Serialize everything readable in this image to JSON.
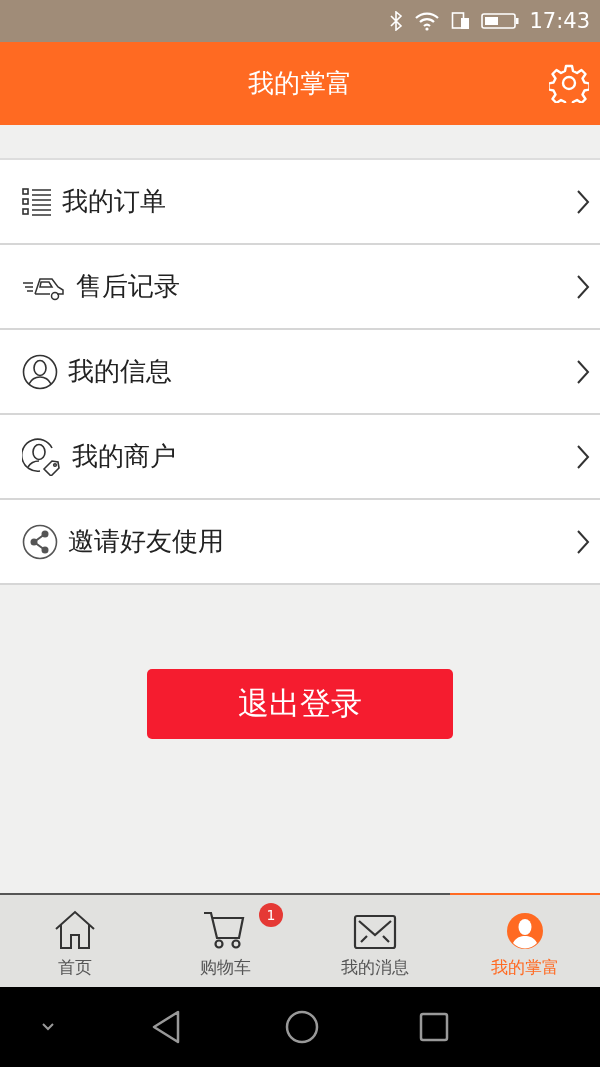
{
  "status_bar": {
    "time": "17:43"
  },
  "header": {
    "title": "我的掌富"
  },
  "menu": [
    {
      "kind": "list",
      "label": "我的订单"
    },
    {
      "kind": "car",
      "label": "售后记录"
    },
    {
      "kind": "person",
      "label": "我的信息"
    },
    {
      "kind": "merchant",
      "label": "我的商户"
    },
    {
      "kind": "share",
      "label": "邀请好友使用"
    }
  ],
  "logout_button": "退出登录",
  "tabs": [
    {
      "kind": "home",
      "label": "首页",
      "selected": false
    },
    {
      "kind": "cart",
      "label": "购物车",
      "selected": false,
      "badge": "1"
    },
    {
      "kind": "mail",
      "label": "我的消息",
      "selected": false
    },
    {
      "kind": "user",
      "label": "我的掌富",
      "selected": true
    }
  ]
}
